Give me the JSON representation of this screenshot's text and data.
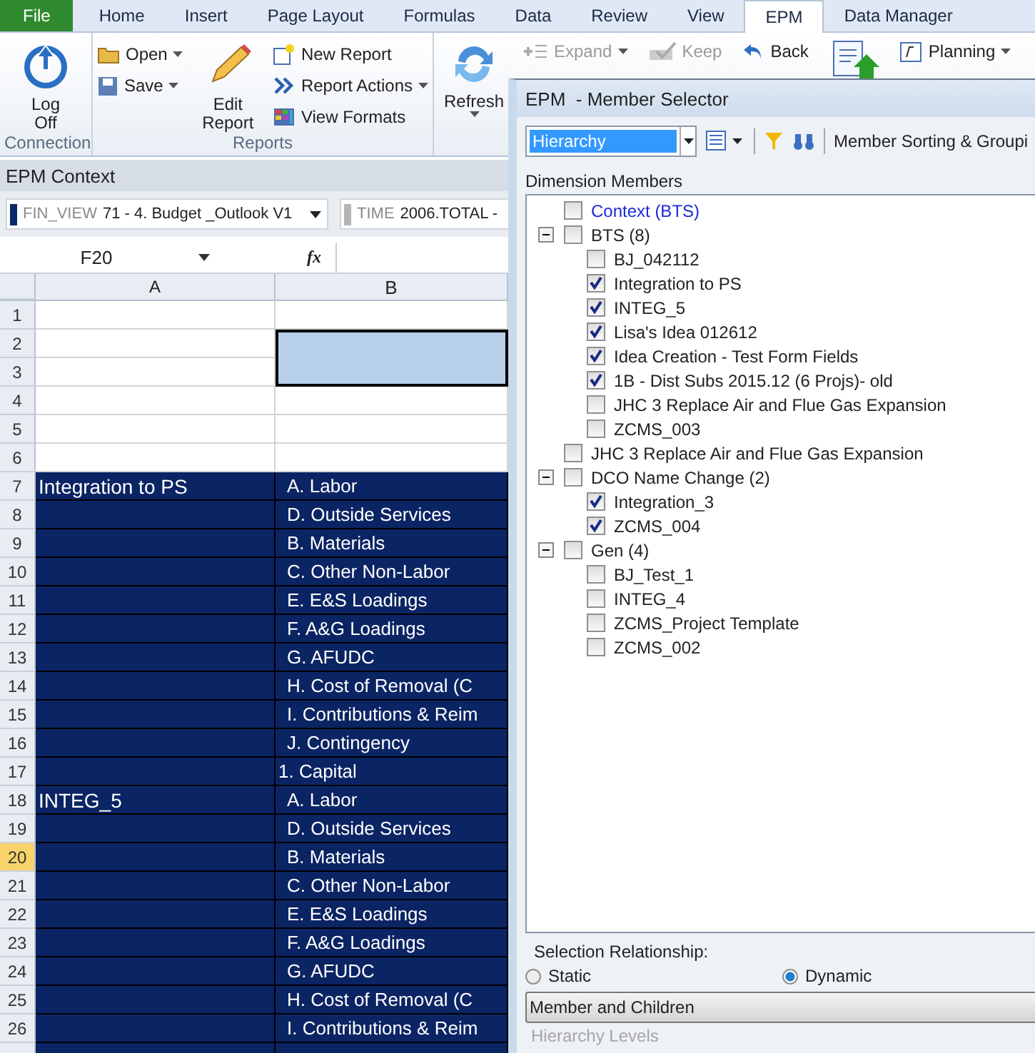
{
  "ribbon_tabs": [
    {
      "label": "File",
      "kind": "file",
      "selected": false
    },
    {
      "label": "Home",
      "kind": "tab",
      "selected": false
    },
    {
      "label": "Insert",
      "kind": "tab",
      "selected": false
    },
    {
      "label": "Page Layout",
      "kind": "tab",
      "selected": false
    },
    {
      "label": "Formulas",
      "kind": "tab",
      "selected": false
    },
    {
      "label": "Data",
      "kind": "tab",
      "selected": false
    },
    {
      "label": "Review",
      "kind": "tab",
      "selected": false
    },
    {
      "label": "View",
      "kind": "tab",
      "selected": false
    },
    {
      "label": "EPM",
      "kind": "tab",
      "selected": true
    },
    {
      "label": "Data Manager",
      "kind": "tab",
      "selected": false
    }
  ],
  "ribbon": {
    "log_off": "Log Off",
    "connection_label": "Connection",
    "open": "Open",
    "save": "Save",
    "edit_report": "Edit Report",
    "new_report": "New Report",
    "report_actions": "Report Actions",
    "view_formats": "View Formats",
    "reports_label": "Reports",
    "refresh": "Refresh",
    "quick": [
      {
        "label": "Expand",
        "kind": "expand",
        "disabled": true
      },
      {
        "label": "Keep",
        "kind": "keep",
        "disabled": true
      },
      {
        "label": "Back",
        "kind": "back",
        "disabled": false
      }
    ],
    "planning": "Planning"
  },
  "context": {
    "title": "EPM Context",
    "fields": [
      {
        "dimension": "FIN_VIEW",
        "value": "71 - 4. Budget _Outlook V1",
        "color": "#0a2a6b"
      },
      {
        "dimension": "TIME",
        "value": "2006.TOTAL -",
        "color": "#b4b4b4"
      }
    ]
  },
  "formula_bar": {
    "name_box": "F20",
    "fx": "fx"
  },
  "sheet": {
    "columns": [
      "A",
      "B"
    ],
    "rows": [
      {
        "num": "1",
        "kind": "blank",
        "selected": false
      },
      {
        "num": "2",
        "kind": "box_top",
        "selected": false
      },
      {
        "num": "3",
        "kind": "box_bottom",
        "selected": false
      },
      {
        "num": "4",
        "kind": "blank",
        "selected": false
      },
      {
        "num": "5",
        "kind": "blank",
        "selected": false
      },
      {
        "num": "6",
        "kind": "blank",
        "selected": false
      },
      {
        "num": "7",
        "kind": "data",
        "a": "Integration to PS",
        "b": "A. Labor",
        "selected": false
      },
      {
        "num": "8",
        "kind": "data",
        "b": "D. Outside Services",
        "selected": false
      },
      {
        "num": "9",
        "kind": "data",
        "b": "B. Materials",
        "selected": false
      },
      {
        "num": "10",
        "kind": "data",
        "b": "C. Other Non-Labor",
        "selected": false
      },
      {
        "num": "11",
        "kind": "data",
        "b": "E. E&S Loadings",
        "selected": false
      },
      {
        "num": "12",
        "kind": "data",
        "b": "F. A&G Loadings",
        "selected": false
      },
      {
        "num": "13",
        "kind": "data",
        "b": "G. AFUDC",
        "selected": false
      },
      {
        "num": "14",
        "kind": "data",
        "b": "H. Cost of Removal (C",
        "selected": false
      },
      {
        "num": "15",
        "kind": "data",
        "b": "I. Contributions & Reim",
        "selected": false
      },
      {
        "num": "16",
        "kind": "data",
        "b": "J. Contingency",
        "selected": false
      },
      {
        "num": "17",
        "kind": "data_total",
        "b": "1. Capital",
        "selected": false
      },
      {
        "num": "18",
        "kind": "data",
        "a": "INTEG_5",
        "b": "A. Labor",
        "selected": false
      },
      {
        "num": "19",
        "kind": "data",
        "b": "D. Outside Services",
        "selected": false
      },
      {
        "num": "20",
        "kind": "data",
        "b": "B. Materials",
        "selected": true
      },
      {
        "num": "21",
        "kind": "data",
        "b": "C. Other Non-Labor",
        "selected": false
      },
      {
        "num": "22",
        "kind": "data",
        "b": "E. E&S Loadings",
        "selected": false
      },
      {
        "num": "23",
        "kind": "data",
        "b": "F. A&G Loadings",
        "selected": false
      },
      {
        "num": "24",
        "kind": "data",
        "b": "G. AFUDC",
        "selected": false
      },
      {
        "num": "25",
        "kind": "data",
        "b": "H. Cost of Removal (C",
        "selected": false
      },
      {
        "num": "26",
        "kind": "data",
        "b": "I. Contributions & Reim",
        "selected": false
      }
    ]
  },
  "dialog": {
    "title": "EPM  - Member Selector",
    "view": "Hierarchy",
    "sorting": "Member Sorting & Groupi",
    "members_label": "Dimension Members",
    "tree": [
      {
        "label": "Context (BTS)",
        "kind": "context",
        "checked": false
      },
      {
        "label": "BTS (8)",
        "kind": "folder",
        "checked": false,
        "expanded": true,
        "children": [
          {
            "label": "BJ_042112",
            "kind": "member",
            "checked": false
          },
          {
            "label": "Integration to PS",
            "kind": "member",
            "checked": true
          },
          {
            "label": "INTEG_5",
            "kind": "member",
            "checked": true
          },
          {
            "label": "Lisa's Idea 012612",
            "kind": "member",
            "checked": true
          },
          {
            "label": "Idea Creation - Test Form Fields",
            "kind": "member",
            "checked": true
          },
          {
            "label": "1B - Dist Subs 2015.12 (6 Projs)- old",
            "kind": "member",
            "checked": true
          },
          {
            "label": "JHC 3 Replace Air and Flue Gas Expansion",
            "kind": "member",
            "checked": false
          },
          {
            "label": "ZCMS_003",
            "kind": "member",
            "checked": false
          }
        ]
      },
      {
        "label": "JHC 3 Replace Air and Flue Gas Expansion",
        "kind": "member",
        "checked": false
      },
      {
        "label": "DCO Name Change (2)",
        "kind": "folder",
        "checked": false,
        "expanded": true,
        "children": [
          {
            "label": "Integration_3",
            "kind": "member",
            "checked": true
          },
          {
            "label": "ZCMS_004",
            "kind": "member",
            "checked": true
          }
        ]
      },
      {
        "label": "Gen (4)",
        "kind": "folder",
        "checked": false,
        "expanded": true,
        "children": [
          {
            "label": "BJ_Test_1",
            "kind": "member",
            "checked": false
          },
          {
            "label": "INTEG_4",
            "kind": "member",
            "checked": false
          },
          {
            "label": "ZCMS_Project Template",
            "kind": "member",
            "checked": false
          },
          {
            "label": "ZCMS_002",
            "kind": "member",
            "checked": false
          }
        ]
      }
    ],
    "selection_relationship": {
      "label": "Selection Relationship:",
      "options": [
        {
          "label": "Static",
          "selected": false
        },
        {
          "label": "Dynamic",
          "selected": true
        }
      ]
    },
    "section": "Member and Children",
    "hierarchy_levels": {
      "label": "Hierarchy Levels",
      "disabled": true
    }
  }
}
